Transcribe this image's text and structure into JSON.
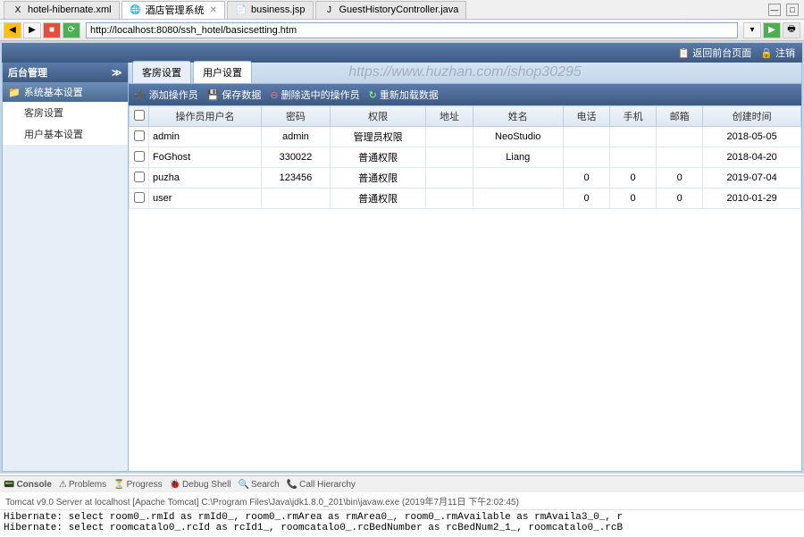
{
  "editor_tabs": {
    "items": [
      {
        "label": "hotel-hibernate.xml",
        "icon": "X"
      },
      {
        "label": "酒店管理系统",
        "icon": "🌐",
        "active": true,
        "closable": true
      },
      {
        "label": "business.jsp",
        "icon": "📄"
      },
      {
        "label": "GuestHistoryController.java",
        "icon": "J"
      }
    ]
  },
  "browser": {
    "url": "http://localhost:8080/ssh_hotel/basicsetting.htm"
  },
  "header": {
    "back_label": "📋 返回前台页面",
    "logout_label": "🔒 注销"
  },
  "sidebar": {
    "title": "后台管理",
    "group_label": "系统基本设置",
    "items": [
      {
        "label": "客房设置"
      },
      {
        "label": "用户基本设置"
      }
    ]
  },
  "content_tabs": {
    "items": [
      {
        "label": "客房设置"
      },
      {
        "label": "用户设置",
        "active": true
      }
    ]
  },
  "watermark": "https://www.huzhan.com/ishop30295",
  "grid_toolbar": {
    "add": "添加操作员",
    "save": "保存数据",
    "delete": "删除选中的操作员",
    "refresh": "重新加载数据"
  },
  "grid": {
    "columns": [
      "",
      "操作员用户名",
      "密码",
      "权限",
      "地址",
      "姓名",
      "电话",
      "手机",
      "邮箱",
      "创建时间"
    ],
    "rows": [
      {
        "username": "admin",
        "password": "admin",
        "role": "管理员权限",
        "address": "",
        "name": "NeoStudio",
        "phone": "",
        "mobile": "",
        "email": "",
        "created": "2018-05-05"
      },
      {
        "username": "FoGhost",
        "password": "330022",
        "role": "普通权限",
        "address": "",
        "name": "Liang",
        "phone": "",
        "mobile": "",
        "email": "",
        "created": "2018-04-20"
      },
      {
        "username": "puzha",
        "password": "123456",
        "role": "普通权限",
        "address": "",
        "name": "",
        "phone": "0",
        "mobile": "0",
        "email": "0",
        "created": "2019-07-04"
      },
      {
        "username": "user",
        "password": "",
        "role": "普通权限",
        "address": "",
        "name": "",
        "phone": "0",
        "mobile": "0",
        "email": "0",
        "created": "2010-01-29"
      }
    ]
  },
  "console": {
    "tabs": [
      "Console",
      "Problems",
      "Progress",
      "Debug Shell",
      "Search",
      "Call Hierarchy"
    ],
    "status": "Tomcat v9.0 Server at localhost [Apache Tomcat] C:\\Program Files\\Java\\jdk1.8.0_201\\bin\\javaw.exe (2019年7月11日 下午2:02:45)",
    "lines": [
      "Hibernate: select room0_.rmId as rmId0_, room0_.rmArea as rmArea0_, room0_.rmAvailable as rmAvaila3_0_, r",
      "Hibernate: select roomcatalo0_.rcId as rcId1_, roomcatalo0_.rcBedNumber as rcBedNum2_1_, roomcatalo0_.rcB"
    ]
  }
}
